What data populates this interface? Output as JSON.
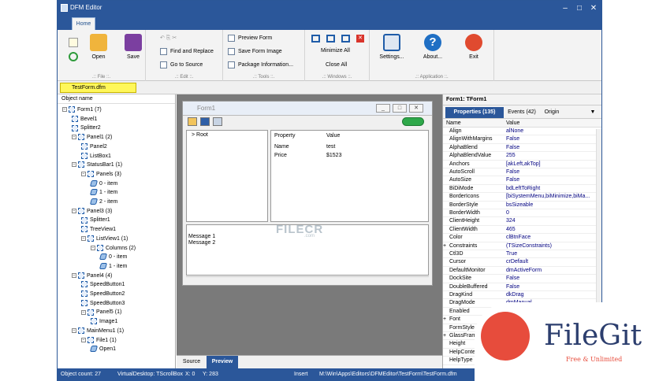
{
  "window": {
    "title": "DFM Editor",
    "tab": "Home",
    "min": "–",
    "max": "□",
    "close": "✕"
  },
  "ribbon": {
    "file": {
      "label": ".:: File ::.",
      "open": "Open",
      "save": "Save"
    },
    "edit": {
      "label": ".:: Edit ::.",
      "find_replace": "Find and Replace",
      "goto": "Go to Source"
    },
    "tools": {
      "label": ".:: Tools ::.",
      "preview": "Preview Form",
      "save_image": "Save Form Image",
      "package": "Package Information..."
    },
    "windows": {
      "label": ".:: Windows ::.",
      "minimize": "Minimize All",
      "close": "Close All"
    },
    "application": {
      "label": ".:: Application ::.",
      "settings": "Settings...",
      "about": "About...",
      "exit": "Exit"
    }
  },
  "document_tab": "TestForm.dfm",
  "object_panel": {
    "header": "Object name",
    "items": [
      "Form1 (7)",
      "Bevel1",
      "Splitter2",
      "Panel1 (2)",
      "Panel2",
      "ListBox1",
      "StatusBar1 (1)",
      "Panels (3)",
      "0 - item",
      "1 - item",
      "2 - item",
      "Panel3 (3)",
      "Splitter1",
      "TreeView1",
      "ListView1 (1)",
      "Columns (2)",
      "0 - item",
      "1 - item",
      "Panel4 (4)",
      "SpeedButton1",
      "SpeedButton2",
      "SpeedButton3",
      "Panel5 (1)",
      "Image1",
      "MainMenu1 (1)",
      "File1 (1)",
      "Open1"
    ]
  },
  "form_preview": {
    "title": "Form1",
    "tree_root": "Root",
    "prop_headers": [
      "Property",
      "Value"
    ],
    "props": [
      [
        "Name",
        "test"
      ],
      [
        "Price",
        "$1523"
      ]
    ],
    "memo": [
      "Message 1",
      "Message 2"
    ]
  },
  "watermark": {
    "brand": "FILECR",
    "sub": ".com"
  },
  "bottom_tabs": [
    "Source",
    "Preview"
  ],
  "inspector": {
    "title": "Form1: TForm1",
    "tabs": [
      "Properties (135)",
      "Events (42)",
      "Origin"
    ],
    "col_name": "Name",
    "col_value": "Value",
    "rows": [
      [
        "Align",
        "alNone"
      ],
      [
        "AlignWithMargins",
        "False"
      ],
      [
        "AlphaBlend",
        "False"
      ],
      [
        "AlphaBlendValue",
        "255"
      ],
      [
        "Anchors",
        "[akLeft,akTop]"
      ],
      [
        "AutoScroll",
        "False"
      ],
      [
        "AutoSize",
        "False"
      ],
      [
        "BiDiMode",
        "bdLeftToRight"
      ],
      [
        "BorderIcons",
        "[biSystemMenu,biMinimize,biMa..."
      ],
      [
        "BorderStyle",
        "bsSizeable"
      ],
      [
        "BorderWidth",
        "0"
      ],
      [
        "ClientHeight",
        "324"
      ],
      [
        "ClientWidth",
        "465"
      ],
      [
        "Color",
        "clBtnFace"
      ],
      [
        "Constraints",
        "(TSizeConstraints)"
      ],
      [
        "Ctl3D",
        "True"
      ],
      [
        "Cursor",
        "crDefault"
      ],
      [
        "DefaultMonitor",
        "dmActiveForm"
      ],
      [
        "DockSite",
        "False"
      ],
      [
        "DoubleBuffered",
        "False"
      ],
      [
        "DragKind",
        "dkDrag"
      ],
      [
        "DragMode",
        "dmManual"
      ],
      [
        "Enabled",
        ""
      ],
      [
        "Font",
        ""
      ],
      [
        "FormStyle",
        ""
      ],
      [
        "GlassFrame",
        ""
      ],
      [
        "Height",
        ""
      ],
      [
        "HelpContext",
        ""
      ],
      [
        "HelpType",
        ""
      ]
    ]
  },
  "status": {
    "count": "Object count: 27",
    "virtual": "VirtualDesktop: TScrollBox",
    "x": "X: 0",
    "y": "Y: 283",
    "mode": "Insert",
    "path": "M:\\Win\\Apps\\Editors\\DFMEditor\\TestForm\\TestForm.dfm"
  },
  "logo": {
    "name": "FileGit",
    "tagline": "Free & Unlimited"
  }
}
